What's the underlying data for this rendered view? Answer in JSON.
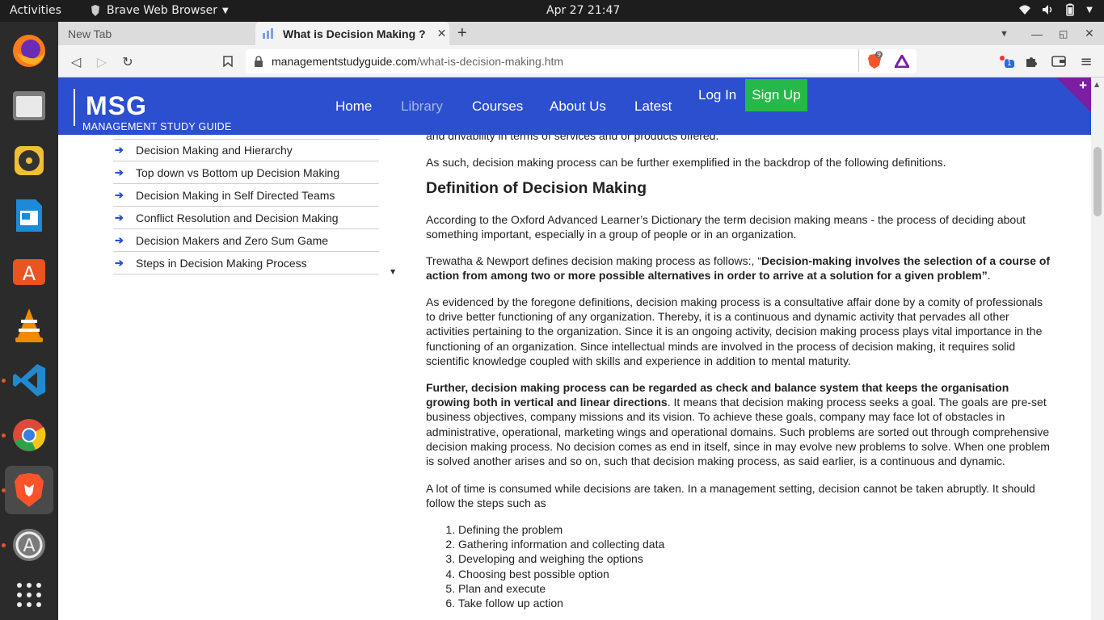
{
  "topbar": {
    "activities": "Activities",
    "app_name": "Brave Web Browser",
    "clock": "Apr 27  21:47"
  },
  "dock": {
    "items": [
      "firefox-icon",
      "files-icon",
      "rhythmbox-icon",
      "writer-icon",
      "software-icon",
      "vlc-icon",
      "vscode-icon",
      "chrome-icon",
      "brave-icon",
      "update-icon",
      "apps-grid-icon"
    ]
  },
  "tabs": [
    {
      "label": "New Tab"
    },
    {
      "label": "What is Decision Making ?"
    }
  ],
  "toolbar": {
    "url_domain": "managementstudyguide.com",
    "url_path": "/what-is-decision-making.htm",
    "shield_count": "9",
    "extension_badge": "1"
  },
  "site": {
    "logo": "MSG",
    "logo_sub": "MANAGEMENT  STUDY  GUIDE",
    "nav": [
      "Home",
      "Library",
      "Courses",
      "About Us",
      "Latest"
    ],
    "login": "Log In",
    "signup": "Sign Up",
    "corner_plus": "+"
  },
  "sidebar": {
    "items": [
      "Decision Making and Hierarchy",
      "Top down vs Bottom up Decision Making",
      "Decision Making in Self Directed Teams",
      "Conflict Resolution and Decision Making",
      "Decision Makers and Zero Sum Game",
      "Steps in Decision Making Process"
    ]
  },
  "article": {
    "cut_line": "and drivability in terms of services and or products offered.",
    "p1": "As such, decision making process can be further exemplified in the backdrop of the following definitions.",
    "heading": "Definition of Decision Making",
    "p2": "According to the Oxford Advanced Learner’s Dictionary the term decision making means - the process of deciding about something important, especially in a group of people or in an organization.",
    "p3_lead": "Trewatha & Newport defines decision making process as follows:, “",
    "p3_bold": "Decision-making involves the selection of a course of action from among two or more possible alternatives in order to arrive at a solution for a given problem”",
    "p3_tail": ".",
    "p4": "As evidenced by the foregone definitions, decision making process is a consultative affair done by a comity of professionals to drive better functioning of any organization. Thereby, it is a continuous and dynamic activity that pervades all other activities pertaining to the organization. Since it is an ongoing activity, decision making process plays vital importance in the functioning of an organization. Since intellectual minds are involved in the process of decision making, it requires solid scientific knowledge coupled with skills and experience in addition to mental maturity.",
    "p5_bold": "Further, decision making process can be regarded as check and balance system that keeps the organisation growing both in vertical and linear directions",
    "p5_tail": ". It means that decision making process seeks a goal. The goals are pre-set business objectives, company missions and its vision. To achieve these goals, company may face lot of obstacles in administrative, operational, marketing wings and operational domains. Such problems are sorted out through comprehensive decision making process. No decision comes as end in itself, since in may evolve new problems to solve. When one problem is solved another arises and so on, such that decision making process, as said earlier, is a continuous and dynamic.",
    "p6": "A lot of time is consumed while decisions are taken. In a management setting, decision cannot be taken abruptly. It should follow the steps such as",
    "steps": [
      "Defining the problem",
      "Gathering information and collecting data",
      "Developing and weighing the options",
      "Choosing best possible option",
      "Plan and execute",
      "Take follow up action"
    ]
  }
}
